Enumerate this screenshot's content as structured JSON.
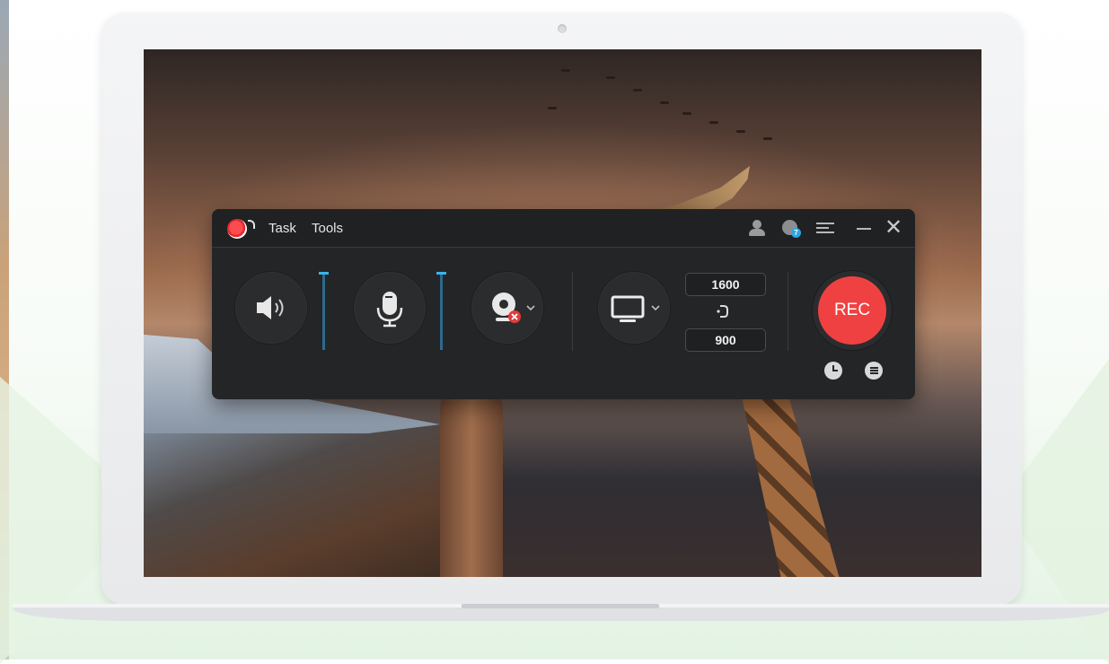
{
  "app": {
    "menu": {
      "task_label": "Task",
      "tools_label": "Tools"
    },
    "notification_count": "7"
  },
  "sources": {
    "speaker_icon": "speaker-icon",
    "mic_icon": "microphone-icon",
    "camera_icon": "webcam-icon",
    "display_icon": "monitor-icon",
    "speaker_level": 1.0,
    "mic_level": 1.0
  },
  "region": {
    "width_value": "1600",
    "height_value": "900"
  },
  "record": {
    "rec_label": "REC",
    "accent_color": "#f04142"
  }
}
